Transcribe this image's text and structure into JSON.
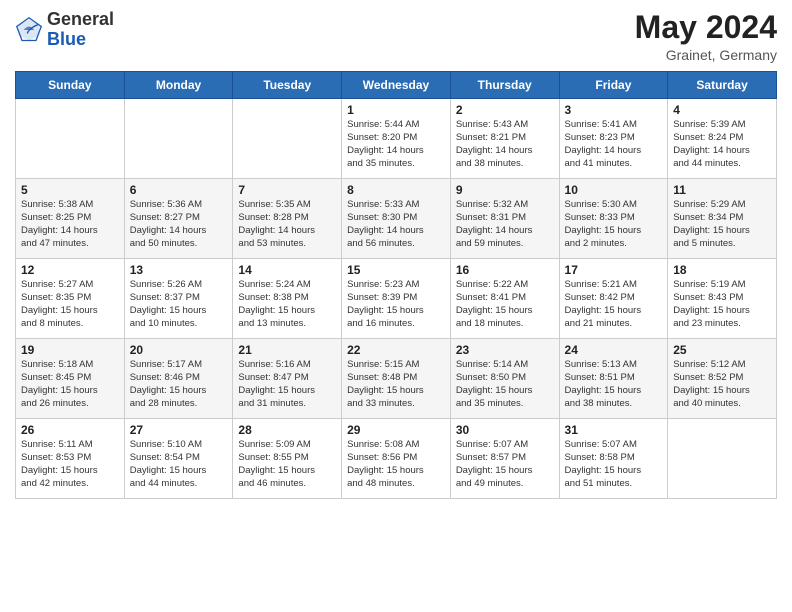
{
  "header": {
    "logo_general": "General",
    "logo_blue": "Blue",
    "month_year": "May 2024",
    "location": "Grainet, Germany"
  },
  "weekdays": [
    "Sunday",
    "Monday",
    "Tuesday",
    "Wednesday",
    "Thursday",
    "Friday",
    "Saturday"
  ],
  "weeks": [
    [
      {
        "day": "",
        "info": ""
      },
      {
        "day": "",
        "info": ""
      },
      {
        "day": "",
        "info": ""
      },
      {
        "day": "1",
        "info": "Sunrise: 5:44 AM\nSunset: 8:20 PM\nDaylight: 14 hours\nand 35 minutes."
      },
      {
        "day": "2",
        "info": "Sunrise: 5:43 AM\nSunset: 8:21 PM\nDaylight: 14 hours\nand 38 minutes."
      },
      {
        "day": "3",
        "info": "Sunrise: 5:41 AM\nSunset: 8:23 PM\nDaylight: 14 hours\nand 41 minutes."
      },
      {
        "day": "4",
        "info": "Sunrise: 5:39 AM\nSunset: 8:24 PM\nDaylight: 14 hours\nand 44 minutes."
      }
    ],
    [
      {
        "day": "5",
        "info": "Sunrise: 5:38 AM\nSunset: 8:25 PM\nDaylight: 14 hours\nand 47 minutes."
      },
      {
        "day": "6",
        "info": "Sunrise: 5:36 AM\nSunset: 8:27 PM\nDaylight: 14 hours\nand 50 minutes."
      },
      {
        "day": "7",
        "info": "Sunrise: 5:35 AM\nSunset: 8:28 PM\nDaylight: 14 hours\nand 53 minutes."
      },
      {
        "day": "8",
        "info": "Sunrise: 5:33 AM\nSunset: 8:30 PM\nDaylight: 14 hours\nand 56 minutes."
      },
      {
        "day": "9",
        "info": "Sunrise: 5:32 AM\nSunset: 8:31 PM\nDaylight: 14 hours\nand 59 minutes."
      },
      {
        "day": "10",
        "info": "Sunrise: 5:30 AM\nSunset: 8:33 PM\nDaylight: 15 hours\nand 2 minutes."
      },
      {
        "day": "11",
        "info": "Sunrise: 5:29 AM\nSunset: 8:34 PM\nDaylight: 15 hours\nand 5 minutes."
      }
    ],
    [
      {
        "day": "12",
        "info": "Sunrise: 5:27 AM\nSunset: 8:35 PM\nDaylight: 15 hours\nand 8 minutes."
      },
      {
        "day": "13",
        "info": "Sunrise: 5:26 AM\nSunset: 8:37 PM\nDaylight: 15 hours\nand 10 minutes."
      },
      {
        "day": "14",
        "info": "Sunrise: 5:24 AM\nSunset: 8:38 PM\nDaylight: 15 hours\nand 13 minutes."
      },
      {
        "day": "15",
        "info": "Sunrise: 5:23 AM\nSunset: 8:39 PM\nDaylight: 15 hours\nand 16 minutes."
      },
      {
        "day": "16",
        "info": "Sunrise: 5:22 AM\nSunset: 8:41 PM\nDaylight: 15 hours\nand 18 minutes."
      },
      {
        "day": "17",
        "info": "Sunrise: 5:21 AM\nSunset: 8:42 PM\nDaylight: 15 hours\nand 21 minutes."
      },
      {
        "day": "18",
        "info": "Sunrise: 5:19 AM\nSunset: 8:43 PM\nDaylight: 15 hours\nand 23 minutes."
      }
    ],
    [
      {
        "day": "19",
        "info": "Sunrise: 5:18 AM\nSunset: 8:45 PM\nDaylight: 15 hours\nand 26 minutes."
      },
      {
        "day": "20",
        "info": "Sunrise: 5:17 AM\nSunset: 8:46 PM\nDaylight: 15 hours\nand 28 minutes."
      },
      {
        "day": "21",
        "info": "Sunrise: 5:16 AM\nSunset: 8:47 PM\nDaylight: 15 hours\nand 31 minutes."
      },
      {
        "day": "22",
        "info": "Sunrise: 5:15 AM\nSunset: 8:48 PM\nDaylight: 15 hours\nand 33 minutes."
      },
      {
        "day": "23",
        "info": "Sunrise: 5:14 AM\nSunset: 8:50 PM\nDaylight: 15 hours\nand 35 minutes."
      },
      {
        "day": "24",
        "info": "Sunrise: 5:13 AM\nSunset: 8:51 PM\nDaylight: 15 hours\nand 38 minutes."
      },
      {
        "day": "25",
        "info": "Sunrise: 5:12 AM\nSunset: 8:52 PM\nDaylight: 15 hours\nand 40 minutes."
      }
    ],
    [
      {
        "day": "26",
        "info": "Sunrise: 5:11 AM\nSunset: 8:53 PM\nDaylight: 15 hours\nand 42 minutes."
      },
      {
        "day": "27",
        "info": "Sunrise: 5:10 AM\nSunset: 8:54 PM\nDaylight: 15 hours\nand 44 minutes."
      },
      {
        "day": "28",
        "info": "Sunrise: 5:09 AM\nSunset: 8:55 PM\nDaylight: 15 hours\nand 46 minutes."
      },
      {
        "day": "29",
        "info": "Sunrise: 5:08 AM\nSunset: 8:56 PM\nDaylight: 15 hours\nand 48 minutes."
      },
      {
        "day": "30",
        "info": "Sunrise: 5:07 AM\nSunset: 8:57 PM\nDaylight: 15 hours\nand 49 minutes."
      },
      {
        "day": "31",
        "info": "Sunrise: 5:07 AM\nSunset: 8:58 PM\nDaylight: 15 hours\nand 51 minutes."
      },
      {
        "day": "",
        "info": ""
      }
    ]
  ]
}
